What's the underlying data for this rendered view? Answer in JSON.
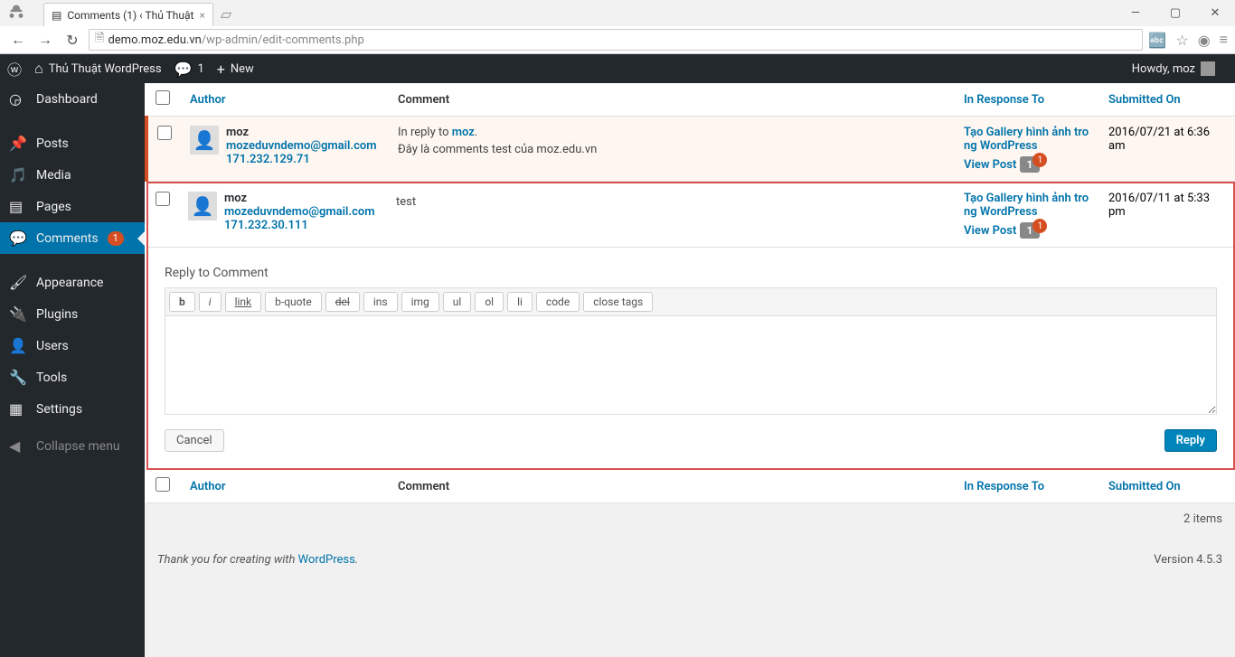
{
  "browser": {
    "tab_title": "Comments (1) ‹ Thủ Thuật",
    "url_host": "demo.moz.edu.vn",
    "url_path": "/wp-admin/edit-comments.php"
  },
  "adminbar": {
    "site_name": "Thủ Thuật WordPress",
    "pending_count": "1",
    "new_label": "New",
    "howdy": "Howdy, moz"
  },
  "menu": {
    "dashboard": "Dashboard",
    "posts": "Posts",
    "media": "Media",
    "pages": "Pages",
    "comments": "Comments",
    "comments_badge": "1",
    "appearance": "Appearance",
    "plugins": "Plugins",
    "users": "Users",
    "tools": "Tools",
    "settings": "Settings",
    "collapse": "Collapse menu"
  },
  "table": {
    "headers": {
      "author": "Author",
      "comment": "Comment",
      "response": "In Response To",
      "date": "Submitted On"
    },
    "rows": [
      {
        "author_name": "moz",
        "author_email": "mozeduvndemo@gmail.com",
        "author_ip": "171.232.129.71",
        "in_reply_prefix": "In reply to ",
        "in_reply_to": "moz",
        "content": "Đây là comments test của moz.edu.vn",
        "response_title": "Tạo Gallery hình ảnh trong WordPress",
        "view_post": "View Post",
        "bubble": "1",
        "bubble_dot": "1",
        "date": "2016/07/21 at 6:36 am"
      },
      {
        "author_name": "moz",
        "author_email": "mozeduvndemo@gmail.com",
        "author_ip": "171.232.30.111",
        "content": "test",
        "response_title": "Tạo Gallery hình ảnh trong WordPress",
        "view_post": "View Post",
        "bubble": "1",
        "bubble_dot": "1",
        "date": "2016/07/11 at 5:33 pm"
      }
    ],
    "items_count": "2 items"
  },
  "reply": {
    "title": "Reply to Comment",
    "quicktags": {
      "b": "b",
      "i": "i",
      "link": "link",
      "bquote": "b-quote",
      "del": "del",
      "ins": "ins",
      "img": "img",
      "ul": "ul",
      "ol": "ol",
      "li": "li",
      "code": "code",
      "close": "close tags"
    },
    "cancel": "Cancel",
    "reply": "Reply"
  },
  "footer": {
    "thanks_prefix": "Thank you for creating with ",
    "wordpress": "WordPress",
    "version": "Version 4.5.3"
  }
}
